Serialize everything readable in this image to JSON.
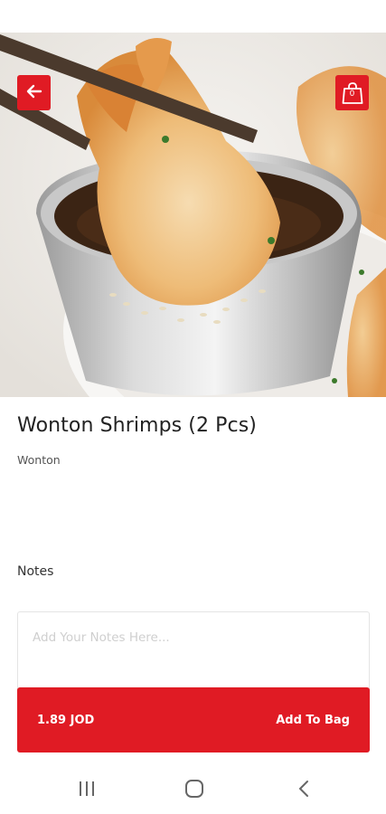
{
  "product": {
    "title": "Wonton Shrimps (2 Pcs)",
    "category": "Wonton",
    "price": "1.89 JOD"
  },
  "header": {
    "back_icon": "arrow-left-icon",
    "bag_icon": "shopping-bag-icon",
    "bag_count": "0"
  },
  "notes": {
    "label": "Notes",
    "placeholder": "Add Your Notes Here..."
  },
  "cart_button": {
    "label": "Add To Bag"
  },
  "nav": {
    "recents_icon": "recents-icon",
    "home_icon": "home-icon",
    "back_icon": "back-chevron-icon"
  },
  "colors": {
    "accent": "#e01b24",
    "title_text": "#222222",
    "placeholder_text": "#cfcfcf"
  }
}
